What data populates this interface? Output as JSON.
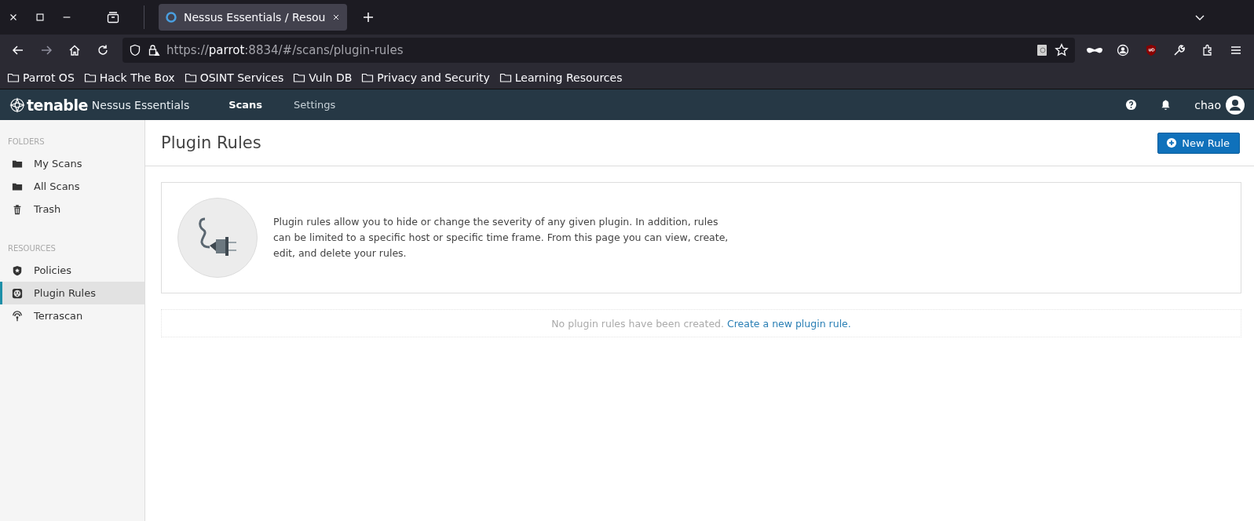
{
  "browser": {
    "tab_title": "Nessus Essentials / Resou",
    "url": "https://**parrot**:8834/#/scans/plugin-rules",
    "bookmarks": [
      "Parrot OS",
      "Hack The Box",
      "OSINT Services",
      "Vuln DB",
      "Privacy and Security",
      "Learning Resources"
    ]
  },
  "header": {
    "logo": "tenable",
    "product": "Nessus Essentials",
    "nav": [
      {
        "label": "Scans",
        "selected": true
      },
      {
        "label": "Settings",
        "selected": false
      }
    ],
    "user": "chao"
  },
  "sidebar": [
    {
      "heading": "FOLDERS",
      "items": [
        {
          "label": "My Scans",
          "kind": "folder",
          "selected": false
        },
        {
          "label": "All Scans",
          "kind": "folder",
          "selected": false
        },
        {
          "label": "Trash",
          "kind": "trash",
          "selected": false
        }
      ]
    },
    {
      "heading": "RESOURCES",
      "items": [
        {
          "label": "Policies",
          "kind": "shield",
          "selected": false
        },
        {
          "label": "Plugin Rules",
          "kind": "outlet",
          "selected": true
        },
        {
          "label": "Terrascan",
          "kind": "signal",
          "selected": false
        }
      ]
    }
  ],
  "page": {
    "title": "Plugin Rules",
    "button": "New Rule",
    "description": "Plugin rules allow you to hide or change the severity of any given plugin. In addition, rules can be limited to a specific host or specific time frame. From this page you can view, create, edit, and delete your rules.",
    "empty_message": "No plugin rules have been created.",
    "empty_link": "Create a new plugin rule."
  }
}
